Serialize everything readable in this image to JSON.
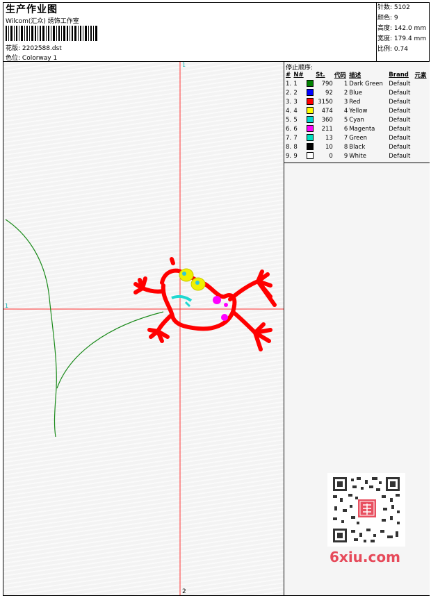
{
  "header": {
    "title": "生产作业图",
    "company": "Wilcom(汇众) 绣饰工作室",
    "file_label": "花版:",
    "file_value": "2202588.dst",
    "colorway_label": "色位:",
    "colorway_value": "Colorway 1"
  },
  "stats": {
    "stitches_label": "针数:",
    "stitches": "5102",
    "colors_label": "颜色:",
    "colors": "9",
    "height_label": "高度:",
    "height": "142.0 mm",
    "width_label": "宽度:",
    "width": "179.4 mm",
    "scale_label": "比例:",
    "scale": "0.74"
  },
  "stop_sequence": {
    "title": "停止顺序:",
    "headers": [
      "#",
      "N#",
      "St.",
      "代码",
      "描述",
      "Brand",
      "元素"
    ],
    "rows": [
      {
        "idx": "1.",
        "n": "1",
        "st": "790",
        "code": "1",
        "desc": "Dark Green",
        "brand": "Default",
        "color": "#008000"
      },
      {
        "idx": "2.",
        "n": "2",
        "st": "92",
        "code": "2",
        "desc": "Blue",
        "brand": "Default",
        "color": "#0000ff"
      },
      {
        "idx": "3.",
        "n": "3",
        "st": "3150",
        "code": "3",
        "desc": "Red",
        "brand": "Default",
        "color": "#ff0000"
      },
      {
        "idx": "4.",
        "n": "4",
        "st": "474",
        "code": "4",
        "desc": "Yellow",
        "brand": "Default",
        "color": "#ffff00"
      },
      {
        "idx": "5.",
        "n": "5",
        "st": "360",
        "code": "5",
        "desc": "Cyan",
        "brand": "Default",
        "color": "#00d8d0"
      },
      {
        "idx": "6.",
        "n": "6",
        "st": "211",
        "code": "6",
        "desc": "Magenta",
        "brand": "Default",
        "color": "#ff00ff"
      },
      {
        "idx": "7.",
        "n": "7",
        "st": "13",
        "code": "7",
        "desc": "Green",
        "brand": "Default",
        "color": "#00e0c0"
      },
      {
        "idx": "8.",
        "n": "8",
        "st": "10",
        "code": "8",
        "desc": "Black",
        "brand": "Default",
        "color": "#000000"
      },
      {
        "idx": "9.",
        "n": "9",
        "st": "0",
        "code": "9",
        "desc": "White",
        "brand": "Default",
        "color": "#ffffff"
      }
    ]
  },
  "canvas": {
    "axis_top": "1",
    "axis_left": "1",
    "axis_bottom": "2",
    "crosshair_color": "#ff0000"
  },
  "watermark": {
    "site": "6xiu.com",
    "seal_text": "汇众图案",
    "qr_icon": "qr-code-icon"
  }
}
